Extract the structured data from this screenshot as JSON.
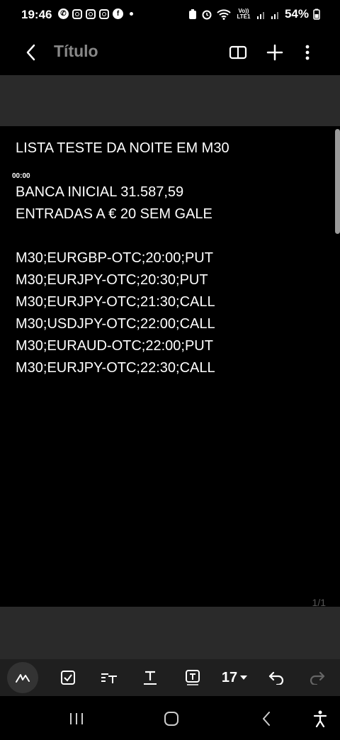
{
  "status_bar": {
    "time": "19:46",
    "left_icons": [
      "whatsapp-icon",
      "instagram-icon",
      "instagram-icon",
      "instagram-icon",
      "facebook-icon",
      "dot-icon"
    ],
    "right_icons": [
      "battery-saver-icon",
      "alarm-icon",
      "wifi-icon",
      "volte-icon",
      "signal-icon",
      "signal-icon",
      "battery-icon"
    ],
    "volte_label": "Vo)) LTE1",
    "battery_percent": "54%"
  },
  "app_bar": {
    "back_icon": "chevron-left-icon",
    "title": "Título",
    "actions": [
      "book-icon",
      "plus-icon",
      "more-vert-icon"
    ]
  },
  "note": {
    "timer": "00:00",
    "lines": [
      "LISTA TESTE DA NOITE EM M30",
      "",
      "BANCA INICIAL 31.587,59",
      "ENTRADAS A € 20 SEM GALE",
      "",
      "M30;EURGBP-OTC;20:00;PUT",
      "M30;EURJPY-OTC;20:30;PUT",
      "M30;EURJPY-OTC;21:30;CALL",
      "M30;USDJPY-OTC;22:00;CALL",
      "M30;EURAUD-OTC;22:00;PUT",
      "M30;EURJPY-OTC;22:30;CALL"
    ],
    "page_indicator": "1/1"
  },
  "toolbar": {
    "items": [
      "pen-icon",
      "checkbox-icon",
      "text-style-icon",
      "underline-text-icon",
      "text-box-icon"
    ],
    "font_size": "17",
    "undo_icon": "undo-icon",
    "redo_icon": "redo-icon"
  },
  "nav_bar": {
    "items": [
      "recents-icon",
      "home-icon",
      "back-icon",
      "accessibility-icon"
    ]
  },
  "colors": {
    "background": "#000000",
    "band": "#2a2a2a",
    "title": "#888888",
    "text": "#ffffff"
  }
}
